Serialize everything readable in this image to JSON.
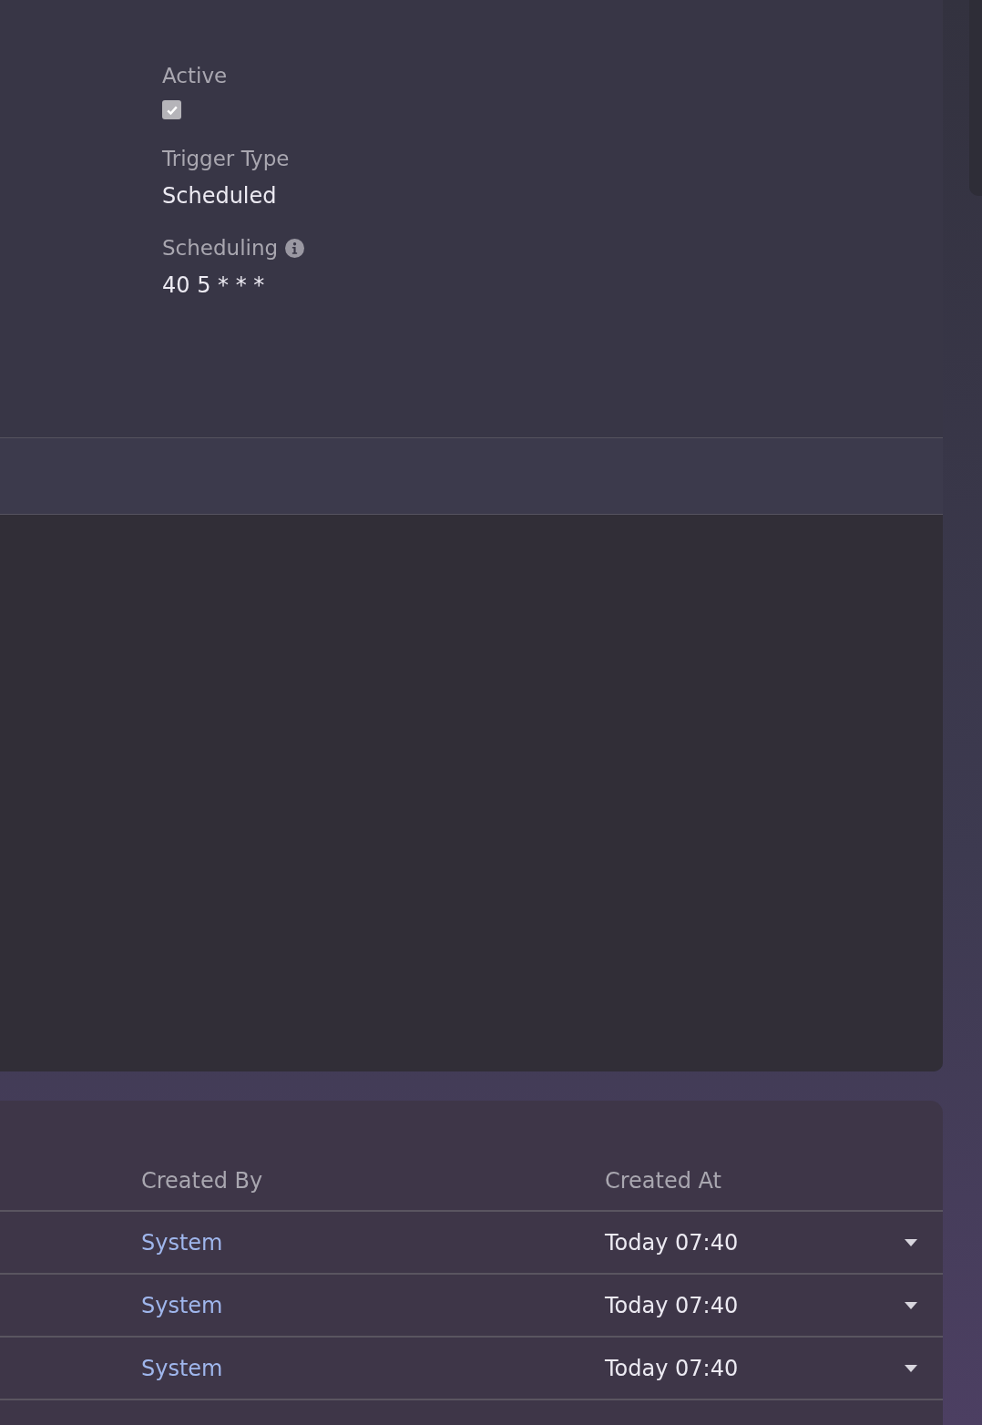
{
  "details": {
    "fields": [
      {
        "kind": "checkbox",
        "label": "Active",
        "checked": true,
        "disabled": true
      },
      {
        "kind": "text",
        "label": "Trigger Type",
        "value": "Scheduled"
      },
      {
        "kind": "text",
        "label": "Scheduling",
        "info": true,
        "value": "40 5 * * *"
      }
    ]
  },
  "table": {
    "columns": [
      "Created By",
      "Created At"
    ],
    "rows": [
      {
        "created_by": "System",
        "created_at": "Today 07:40"
      },
      {
        "created_by": "System",
        "created_at": "Today 07:40"
      },
      {
        "created_by": "System",
        "created_at": "Today 07:40"
      }
    ]
  }
}
